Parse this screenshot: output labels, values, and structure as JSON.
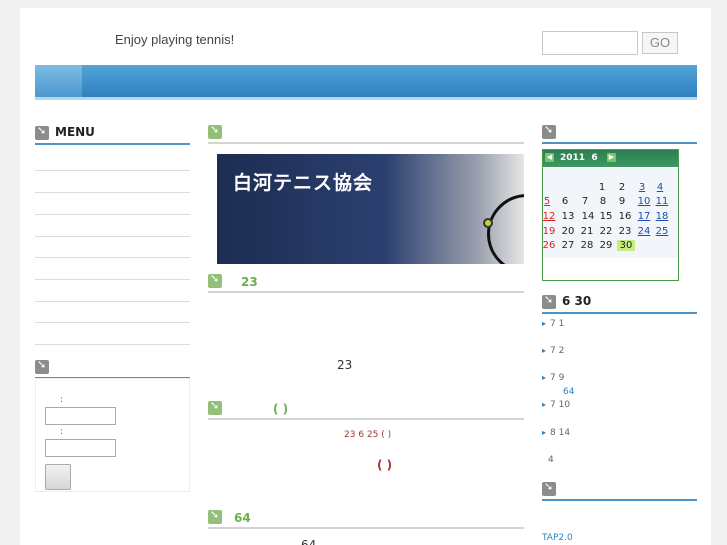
{
  "header": {
    "tagline": "Enjoy playing tennis!",
    "search_placeholder": "",
    "go_label": "GO"
  },
  "left": {
    "menu_title": "MENU",
    "login": {
      "title": "",
      "user_label": ":",
      "password_label": ":"
    }
  },
  "center": {
    "banner_title": "白河テニス協会",
    "sections": [
      {
        "title": "23",
        "body": "23"
      },
      {
        "title": "( )",
        "date_line": "23 6 25 ( )",
        "body": "( )"
      },
      {
        "title": "64",
        "body": "64"
      }
    ]
  },
  "calendar": {
    "year": "2011",
    "month": "6",
    "prev_icon": "prev-arrow-icon",
    "next_icon": "next-arrow-icon",
    "today": "30",
    "link_color": "#1a4fb4",
    "sunday_color": "#d22222"
  },
  "right": {
    "updates_title": "6 30",
    "items": [
      "7 1",
      "7 2",
      "7 9",
      "7 10",
      "8 14"
    ],
    "sub_item": "64",
    "count": "4",
    "tap_link": "TAP2.0"
  },
  "colors": {
    "accent_blue": "#2f80bf",
    "accent_green": "#6ab04c",
    "calendar_green": "#3b9a60"
  }
}
